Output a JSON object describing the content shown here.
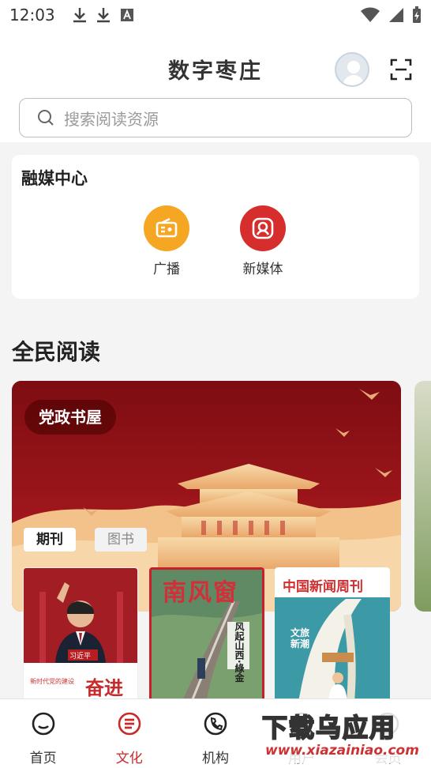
{
  "status_bar": {
    "time": "12:03"
  },
  "header": {
    "title": "数字枣庄"
  },
  "search": {
    "placeholder": "搜索阅读资源"
  },
  "media_center": {
    "title": "融媒中心",
    "items": [
      {
        "label": "广播",
        "icon": "radio-icon",
        "color": "#f5a623"
      },
      {
        "label": "新媒体",
        "icon": "new-media-icon",
        "color": "#d62d2d"
      }
    ]
  },
  "reading": {
    "title": "全民阅读",
    "banner": {
      "badge": "党政书屋",
      "tabs": [
        "期刊",
        "图书"
      ]
    },
    "covers": [
      {
        "name": "习近平",
        "headline": "奋进",
        "subline": "新时代党的建设"
      },
      {
        "name": "南风窗",
        "headline": "风起山西·綠金"
      },
      {
        "name": "中国新闻周刊",
        "headline": "文旅新潮"
      }
    ]
  },
  "bottom_nav": {
    "items": [
      {
        "label": "首页",
        "icon": "home-icon",
        "active": false
      },
      {
        "label": "文化",
        "icon": "culture-icon",
        "active": true
      },
      {
        "label": "机构",
        "icon": "institution-icon",
        "active": false
      },
      {
        "label": "用户",
        "icon": "user-icon",
        "active": false
      },
      {
        "label": "会员",
        "icon": "member-icon",
        "active": false
      }
    ]
  },
  "watermark": {
    "main": "下载乌应用",
    "sub": "www.xiazainiao.com"
  },
  "colors": {
    "accent": "#c62a2a",
    "radio": "#f5a623",
    "media": "#d62d2d"
  }
}
